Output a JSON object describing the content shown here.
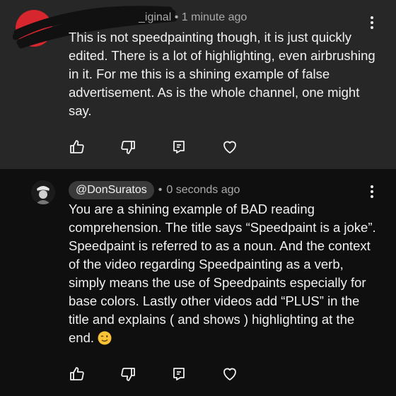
{
  "comments": [
    {
      "author_partial": "_iginal",
      "separator": "•",
      "time": "1 minute ago",
      "text": "This is not speedpainting though, it is just quickly edited. There is a lot of highlighting, even airbrushing in it. For me this is a shining example of false advertisement. As is the whole channel, one might say.",
      "avatar_color": "#d8262f"
    },
    {
      "author": "@DonSuratos",
      "separator": "•",
      "time": "0 seconds ago",
      "text": "You are a shining example of BAD reading comprehension. The title says “Speedpaint is a joke”. Speedpaint is referred to as a noun. And the context of the video regarding Speedpainting as a verb, simply means the use of Speedpaints especially for base colors. Lastly other videos add “PLUS” in the title and explains ( and shows ) highlighting at the end.",
      "emoji": "winking-face"
    }
  ],
  "icons": {
    "like": "thumbs-up-icon",
    "dislike": "thumbs-down-icon",
    "reply": "reply-icon",
    "heart": "heart-icon",
    "more": "more-vertical-icon"
  },
  "colors": {
    "background": "#0f0f0f",
    "highlighted_background": "#272727",
    "text": "#f1f1f1",
    "muted": "#aaaaaa",
    "chip": "#3a3a3a"
  }
}
